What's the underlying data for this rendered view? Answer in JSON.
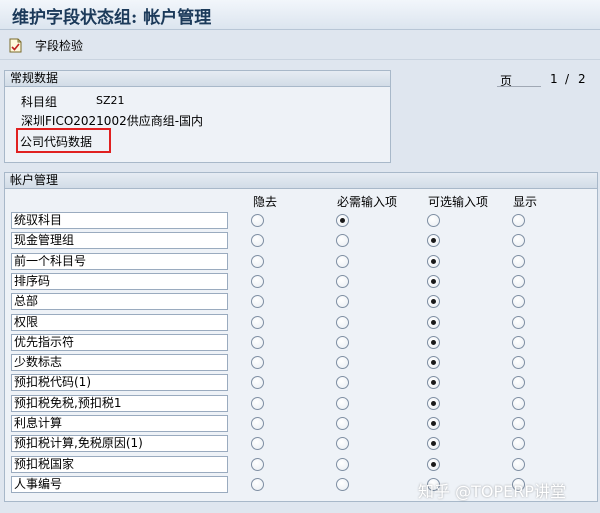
{
  "window": {
    "title": "维护字段状态组: 帐户管理"
  },
  "toolbar": {
    "field_check_label": "字段检验",
    "field_check_icon": "document-check-icon"
  },
  "general": {
    "section_title": "常规数据",
    "account_group_label": "科目组",
    "account_group_value": "SZ21",
    "description": "深圳FICO2021002供应商组-国内",
    "company_code_data": "公司代码数据"
  },
  "pager": {
    "label": "页",
    "current": "1",
    "separator": "/",
    "total": "2"
  },
  "account": {
    "section_title": "帐户管理",
    "columns": [
      "隐去",
      "必需输入项",
      "可选输入项",
      "显示"
    ],
    "rows": [
      {
        "label": "统驭科目",
        "selected": 1
      },
      {
        "label": "现金管理组",
        "selected": 2
      },
      {
        "label": "前一个科目号",
        "selected": 2
      },
      {
        "label": "排序码",
        "selected": 2
      },
      {
        "label": "总部",
        "selected": 2
      },
      {
        "label": "权限",
        "selected": 2
      },
      {
        "label": "优先指示符",
        "selected": 2
      },
      {
        "label": "少数标志",
        "selected": 2
      },
      {
        "label": "预扣税代码(1)",
        "selected": 2
      },
      {
        "label": "预扣税免税,预扣税1",
        "selected": 2
      },
      {
        "label": "利息计算",
        "selected": 2
      },
      {
        "label": "预扣税计算,免税原因(1)",
        "selected": 2
      },
      {
        "label": "预扣税国家",
        "selected": 2
      },
      {
        "label": "人事编号",
        "selected": -1
      }
    ]
  },
  "watermark": "知乎 @TOPERP讲堂",
  "colors": {
    "highlight_border": "#e02020",
    "title_text": "#1c3a5a"
  }
}
